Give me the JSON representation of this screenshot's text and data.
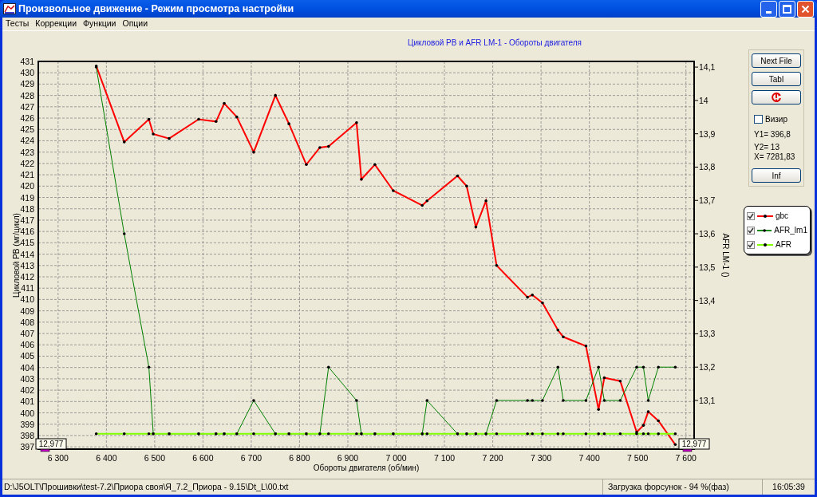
{
  "window": {
    "title": "Произвольное движение - Режим просмотра настройки"
  },
  "menu": [
    {
      "label": "Тесты"
    },
    {
      "label": "Коррекции"
    },
    {
      "label": "Функции"
    },
    {
      "label": "Опции"
    }
  ],
  "chart": {
    "chart_data": {
      "type": "line",
      "title": "Цикловой РВ и AFR LM-1 - Обороты двигателя",
      "xlabel": "Обороты двигателя (об/мин)",
      "ylabel": "Цикловой РВ (мг/цикл)",
      "y2label": "AFR LM-1 ()",
      "x": [
        6379,
        6437,
        6488,
        6497,
        6530,
        6591,
        6627,
        6644,
        6670,
        6705,
        6750,
        6778,
        6814,
        6842,
        6860,
        6918,
        6928,
        6956,
        6994,
        7054,
        7064,
        7127,
        7146,
        7165,
        7186,
        7208,
        7272,
        7282,
        7303,
        7335,
        7346,
        7393,
        7419,
        7431,
        7464,
        7498,
        7512,
        7522,
        7543,
        7578
      ],
      "series": [
        {
          "name": "gbc",
          "color": "#ff0000",
          "values": [
            430.6,
            423.9,
            425.9,
            424.6,
            424.2,
            425.9,
            425.7,
            427.3,
            426.1,
            423.0,
            428.0,
            425.5,
            421.9,
            423.4,
            423.5,
            425.6,
            420.6,
            421.9,
            419.6,
            418.3,
            418.7,
            420.9,
            420.0,
            416.4,
            418.7,
            413.0,
            410.2,
            410.4,
            409.7,
            407.3,
            406.7,
            405.9,
            400.3,
            403.1,
            402.8,
            398.3,
            398.9,
            400.1,
            399.3,
            397.2
          ]
        },
        {
          "name": "AFR_lm1",
          "color": "#008000",
          "axis": "y2",
          "values": [
            14.1,
            13.6,
            13.2,
            13.0,
            13.0,
            13.0,
            13.0,
            13.0,
            13.0,
            13.1,
            13.0,
            13.0,
            13.0,
            13.0,
            13.2,
            13.1,
            13.0,
            13.0,
            13.0,
            13.0,
            13.1,
            13.0,
            13.0,
            13.0,
            13.0,
            13.1,
            13.1,
            13.1,
            13.1,
            13.2,
            13.1,
            13.1,
            13.2,
            13.1,
            13.1,
            13.2,
            13.2,
            13.1,
            13.2,
            13.2
          ]
        },
        {
          "name": "AFR",
          "color": "#80ff00",
          "axis": "y2",
          "values": [
            13.0,
            13.0,
            13.0,
            13.0,
            13.0,
            13.0,
            13.0,
            13.0,
            13.0,
            13.0,
            13.0,
            13.0,
            13.0,
            13.0,
            13.0,
            13.0,
            13.0,
            13.0,
            13.0,
            13.0,
            13.0,
            13.0,
            13.0,
            13.0,
            13.0,
            13.0,
            13.0,
            13.0,
            13.0,
            13.0,
            13.0,
            13.0,
            13.0,
            13.0,
            13.0,
            13.0,
            13.0,
            13.0,
            13.0,
            13.0
          ]
        }
      ],
      "xlim": [
        6259,
        7617
      ],
      "ylim": [
        396.8,
        431
      ],
      "y2lim": [
        12.954,
        14.117
      ],
      "xticks": [
        {
          "value": 6300,
          "label": "6 300"
        },
        {
          "value": 6400,
          "label": "6 400"
        },
        {
          "value": 6500,
          "label": "6 500"
        },
        {
          "value": 6600,
          "label": "6 600"
        },
        {
          "value": 6700,
          "label": "6 700"
        },
        {
          "value": 6800,
          "label": "6 800"
        },
        {
          "value": 6900,
          "label": "6 900"
        },
        {
          "value": 7000,
          "label": "7 000"
        },
        {
          "value": 7100,
          "label": "7 100"
        },
        {
          "value": 7200,
          "label": "7 200"
        },
        {
          "value": 7300,
          "label": "7 300"
        },
        {
          "value": 7400,
          "label": "7 400"
        },
        {
          "value": 7500,
          "label": "7 500"
        },
        {
          "value": 7600,
          "label": "7 600"
        }
      ],
      "grid": true,
      "yticks": [
        397,
        398,
        399,
        400,
        401,
        402,
        403,
        404,
        405,
        406,
        407,
        408,
        409,
        410,
        411,
        412,
        413,
        414,
        415,
        416,
        417,
        418,
        419,
        420,
        421,
        422,
        423,
        424,
        425,
        426,
        427,
        428,
        429,
        430,
        431
      ],
      "y2ticks": [
        {
          "value": 13.1,
          "label": "13,1"
        },
        {
          "value": 13.2,
          "label": "13,2"
        },
        {
          "value": 13.3,
          "label": "13,3"
        },
        {
          "value": 13.4,
          "label": "13,4"
        },
        {
          "value": 13.5,
          "label": "13,5"
        },
        {
          "value": 13.6,
          "label": "13,6"
        },
        {
          "value": 13.7,
          "label": "13,7"
        },
        {
          "value": 13.8,
          "label": "13,8"
        },
        {
          "value": 13.9,
          "label": "13,9"
        },
        {
          "value": 14,
          "label": "14"
        },
        {
          "value": 14.1,
          "label": "14,1"
        }
      ],
      "annotations": [
        {
          "text": "12,977",
          "x": 6284
        },
        {
          "text": "12,977",
          "x": 7617
        }
      ]
    }
  },
  "legend": [
    {
      "checked": true
    },
    {
      "checked": true
    },
    {
      "checked": true
    }
  ],
  "side_panel": {
    "buttons": [
      {
        "kind": "text",
        "label": "Next File"
      },
      {
        "kind": "text",
        "label": "Tabl"
      },
      {
        "kind": "icon"
      }
    ],
    "sight": {
      "label": "Визир",
      "checked": false
    },
    "readings": [
      "Y1= 396,8",
      "Y2= 13",
      "X= 7281,83"
    ],
    "info_button": "Inf"
  },
  "status_bar": {
    "file_path": "D:\\J5OLT\\Прошивки\\test-7.2\\Приора своя\\Я_7.2_Приора - 9.15\\Dt_L\\00.txt",
    "injector_load": "Загрузка форсунок - 94 %(фаз)",
    "time": "16:05:39"
  }
}
